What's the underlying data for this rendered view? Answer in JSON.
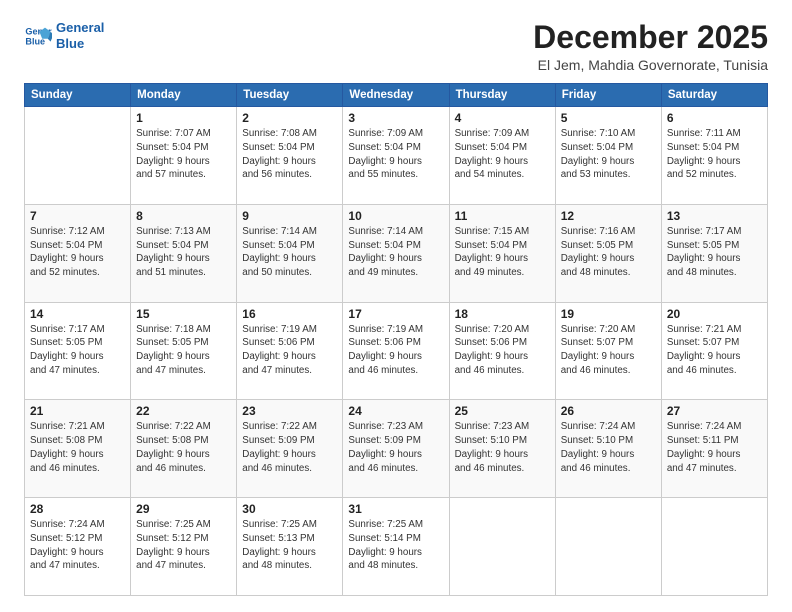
{
  "logo": {
    "line1": "General",
    "line2": "Blue"
  },
  "title": "December 2025",
  "subtitle": "El Jem, Mahdia Governorate, Tunisia",
  "weekdays": [
    "Sunday",
    "Monday",
    "Tuesday",
    "Wednesday",
    "Thursday",
    "Friday",
    "Saturday"
  ],
  "weeks": [
    [
      {
        "day": "",
        "info": ""
      },
      {
        "day": "1",
        "info": "Sunrise: 7:07 AM\nSunset: 5:04 PM\nDaylight: 9 hours\nand 57 minutes."
      },
      {
        "day": "2",
        "info": "Sunrise: 7:08 AM\nSunset: 5:04 PM\nDaylight: 9 hours\nand 56 minutes."
      },
      {
        "day": "3",
        "info": "Sunrise: 7:09 AM\nSunset: 5:04 PM\nDaylight: 9 hours\nand 55 minutes."
      },
      {
        "day": "4",
        "info": "Sunrise: 7:09 AM\nSunset: 5:04 PM\nDaylight: 9 hours\nand 54 minutes."
      },
      {
        "day": "5",
        "info": "Sunrise: 7:10 AM\nSunset: 5:04 PM\nDaylight: 9 hours\nand 53 minutes."
      },
      {
        "day": "6",
        "info": "Sunrise: 7:11 AM\nSunset: 5:04 PM\nDaylight: 9 hours\nand 52 minutes."
      }
    ],
    [
      {
        "day": "7",
        "info": "Sunrise: 7:12 AM\nSunset: 5:04 PM\nDaylight: 9 hours\nand 52 minutes."
      },
      {
        "day": "8",
        "info": "Sunrise: 7:13 AM\nSunset: 5:04 PM\nDaylight: 9 hours\nand 51 minutes."
      },
      {
        "day": "9",
        "info": "Sunrise: 7:14 AM\nSunset: 5:04 PM\nDaylight: 9 hours\nand 50 minutes."
      },
      {
        "day": "10",
        "info": "Sunrise: 7:14 AM\nSunset: 5:04 PM\nDaylight: 9 hours\nand 49 minutes."
      },
      {
        "day": "11",
        "info": "Sunrise: 7:15 AM\nSunset: 5:04 PM\nDaylight: 9 hours\nand 49 minutes."
      },
      {
        "day": "12",
        "info": "Sunrise: 7:16 AM\nSunset: 5:05 PM\nDaylight: 9 hours\nand 48 minutes."
      },
      {
        "day": "13",
        "info": "Sunrise: 7:17 AM\nSunset: 5:05 PM\nDaylight: 9 hours\nand 48 minutes."
      }
    ],
    [
      {
        "day": "14",
        "info": "Sunrise: 7:17 AM\nSunset: 5:05 PM\nDaylight: 9 hours\nand 47 minutes."
      },
      {
        "day": "15",
        "info": "Sunrise: 7:18 AM\nSunset: 5:05 PM\nDaylight: 9 hours\nand 47 minutes."
      },
      {
        "day": "16",
        "info": "Sunrise: 7:19 AM\nSunset: 5:06 PM\nDaylight: 9 hours\nand 47 minutes."
      },
      {
        "day": "17",
        "info": "Sunrise: 7:19 AM\nSunset: 5:06 PM\nDaylight: 9 hours\nand 46 minutes."
      },
      {
        "day": "18",
        "info": "Sunrise: 7:20 AM\nSunset: 5:06 PM\nDaylight: 9 hours\nand 46 minutes."
      },
      {
        "day": "19",
        "info": "Sunrise: 7:20 AM\nSunset: 5:07 PM\nDaylight: 9 hours\nand 46 minutes."
      },
      {
        "day": "20",
        "info": "Sunrise: 7:21 AM\nSunset: 5:07 PM\nDaylight: 9 hours\nand 46 minutes."
      }
    ],
    [
      {
        "day": "21",
        "info": "Sunrise: 7:21 AM\nSunset: 5:08 PM\nDaylight: 9 hours\nand 46 minutes."
      },
      {
        "day": "22",
        "info": "Sunrise: 7:22 AM\nSunset: 5:08 PM\nDaylight: 9 hours\nand 46 minutes."
      },
      {
        "day": "23",
        "info": "Sunrise: 7:22 AM\nSunset: 5:09 PM\nDaylight: 9 hours\nand 46 minutes."
      },
      {
        "day": "24",
        "info": "Sunrise: 7:23 AM\nSunset: 5:09 PM\nDaylight: 9 hours\nand 46 minutes."
      },
      {
        "day": "25",
        "info": "Sunrise: 7:23 AM\nSunset: 5:10 PM\nDaylight: 9 hours\nand 46 minutes."
      },
      {
        "day": "26",
        "info": "Sunrise: 7:24 AM\nSunset: 5:10 PM\nDaylight: 9 hours\nand 46 minutes."
      },
      {
        "day": "27",
        "info": "Sunrise: 7:24 AM\nSunset: 5:11 PM\nDaylight: 9 hours\nand 47 minutes."
      }
    ],
    [
      {
        "day": "28",
        "info": "Sunrise: 7:24 AM\nSunset: 5:12 PM\nDaylight: 9 hours\nand 47 minutes."
      },
      {
        "day": "29",
        "info": "Sunrise: 7:25 AM\nSunset: 5:12 PM\nDaylight: 9 hours\nand 47 minutes."
      },
      {
        "day": "30",
        "info": "Sunrise: 7:25 AM\nSunset: 5:13 PM\nDaylight: 9 hours\nand 48 minutes."
      },
      {
        "day": "31",
        "info": "Sunrise: 7:25 AM\nSunset: 5:14 PM\nDaylight: 9 hours\nand 48 minutes."
      },
      {
        "day": "",
        "info": ""
      },
      {
        "day": "",
        "info": ""
      },
      {
        "day": "",
        "info": ""
      }
    ]
  ]
}
